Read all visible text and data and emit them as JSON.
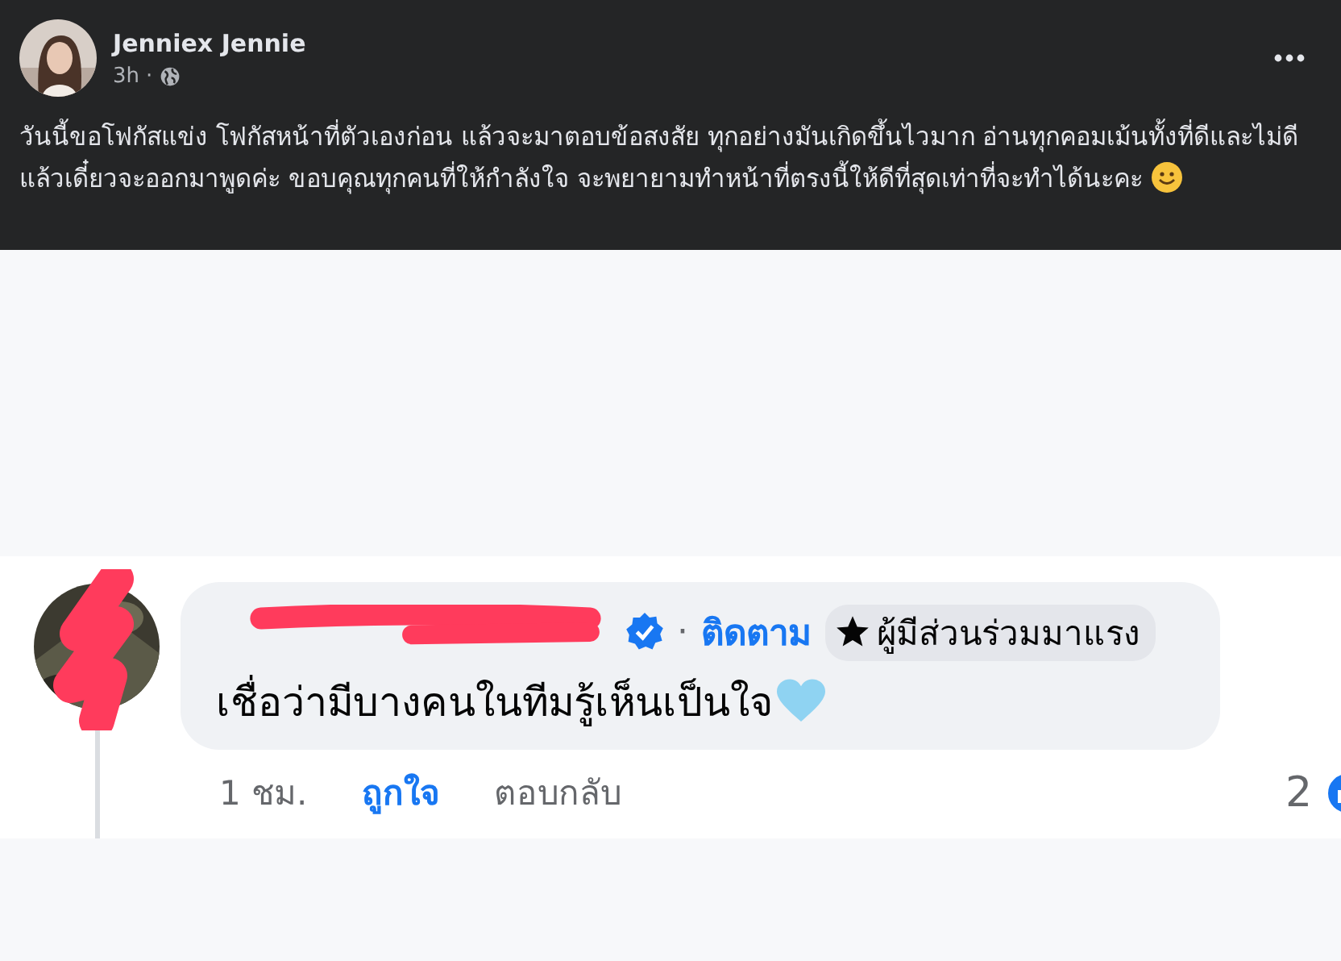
{
  "post": {
    "author": "Jenniex Jennie",
    "time": "3h",
    "separator": "·",
    "text": "วันนี้ขอโฟกัสแข่ง โฟกัสหน้าที่ตัวเองก่อน แล้วจะมาตอบข้อสงสัย ทุกอย่างมันเกิดขึ้นไวมาก อ่านทุกคอมเม้นทั้งที่ดีและไม่ดี แล้วเดี๋ยวจะออกมาพูดค่ะ ขอบคุณทุกคนที่ให้กำลังใจ จะพยายามทำหน้าที่ตรงนี้ให้ดีที่สุดเท่าที่จะทำได้นะคะ"
  },
  "comment": {
    "verified": true,
    "separator": "·",
    "follow_link": "ติดตาม",
    "badge": "ผู้มีส่วนร่วมมาแรง",
    "text": "เชื่อว่ามีบางคนในทีมรู้เห็นเป็นใจ",
    "time": "1 ชม.",
    "like": "ถูกใจ",
    "reply": "ตอบกลับ",
    "reaction_count": "2"
  }
}
